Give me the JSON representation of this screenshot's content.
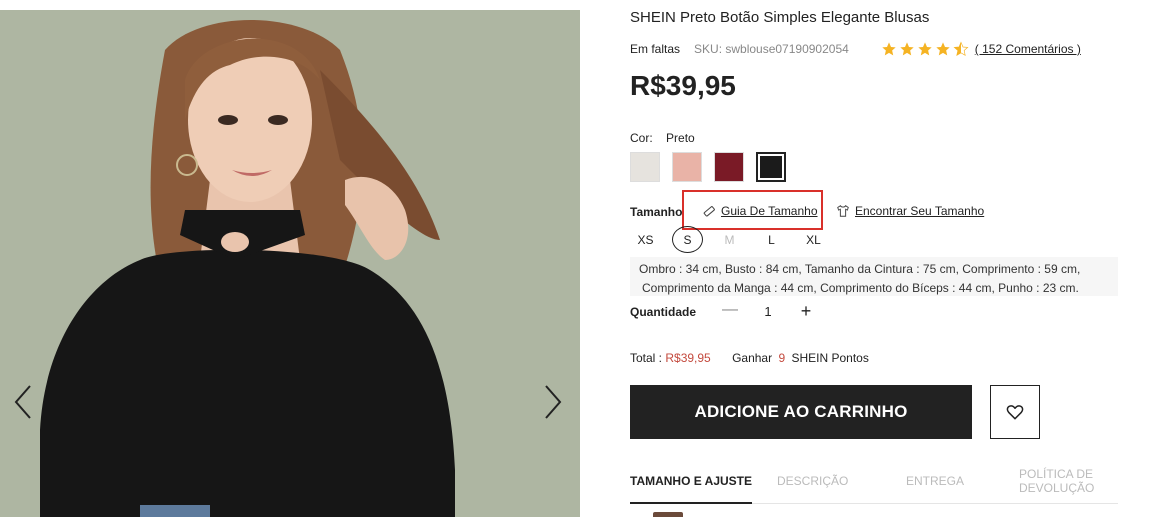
{
  "product": {
    "title": "SHEIN Preto Botão Simples Elegante Blusas",
    "stock_status": "Em faltas",
    "sku": "SKU: swblouse07190902054",
    "rating": 4.5,
    "reviews_label": "( 152 Comentários )",
    "price": "R$39,95"
  },
  "color": {
    "label": "Cor:",
    "selected": "Preto",
    "swatches": [
      {
        "name": "Branco",
        "hex": "#e6e3de"
      },
      {
        "name": "Rosa",
        "hex": "#e9b3a7"
      },
      {
        "name": "Vinho",
        "hex": "#7a1a26"
      },
      {
        "name": "Preto",
        "hex": "#1b1b1b"
      }
    ]
  },
  "size": {
    "label": "Tamanho",
    "guide_label": "Guia De Tamanho",
    "finder_label": "Encontrar Seu Tamanho",
    "options": [
      "XS",
      "S",
      "M",
      "L",
      "XL"
    ],
    "selected": "S",
    "unavailable": [
      "M"
    ],
    "measurements_line1": "Ombro : 34 cm,  Busto : 84 cm,  Tamanho da Cintura : 75 cm,  Comprimento : 59 cm,",
    "measurements_line2": "Comprimento da Manga : 44 cm,  Comprimento do Bíceps : 44 cm,  Punho : 23 cm."
  },
  "quantity": {
    "label": "Quantidade",
    "minus": "—",
    "value": "1",
    "plus": "+"
  },
  "total": {
    "label": "Total :",
    "amount": "R$39,95",
    "earn_label": "Ganhar",
    "points": "9",
    "points_label": "SHEIN Pontos"
  },
  "actions": {
    "add_to_cart": "ADICIONE AO CARRINHO"
  },
  "tabs": [
    {
      "label": "TAMANHO E AJUSTE",
      "active": true
    },
    {
      "label": "DESCRIÇÃO",
      "active": false
    },
    {
      "label": "ENTREGA",
      "active": false
    },
    {
      "label": "POLÍTICA DE DEVOLUÇÃO",
      "active": false
    }
  ],
  "tabs_extra": {
    "policy_line1": "POLÍTICA DE",
    "policy_line2": "DEVOLUÇÃO"
  },
  "colors": {
    "accent_red": "#c44a3e",
    "highlight_border": "#d9302a",
    "star": "#f5b323",
    "button_dark": "#222222"
  },
  "icons": {
    "prev": "chevron-left-icon",
    "next": "chevron-right-icon",
    "star": "star-icon",
    "ruler": "ruler-icon",
    "shirt": "shirt-icon",
    "heart": "heart-icon"
  }
}
